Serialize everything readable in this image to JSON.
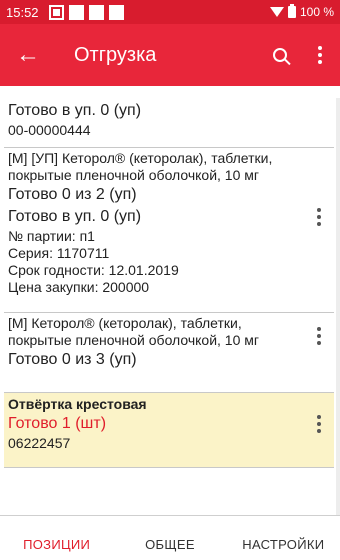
{
  "status_bar": {
    "time": "15:52",
    "battery": "100 %"
  },
  "app_bar": {
    "title": "Отгрузка",
    "icons": [
      "back-arrow-icon",
      "search-icon",
      "more-vert-icon"
    ]
  },
  "items": [
    {
      "line1": "Готово в уп. 0 (уп)",
      "line2": "00-00000444"
    },
    {
      "name": "[М] [УП] Кеторол® (кеторолак), таблетки, покрытые пленочной оболочкой, 10 мг",
      "ready": "Готово 0 из 2 (уп)",
      "ready_pack": "Готово в уп. 0 (уп)",
      "batch": "№ партии: п1",
      "series": "Серия: 1170711",
      "expiry": "Срок годности: 12.01.2019",
      "price": "Цена закупки: 200000"
    },
    {
      "name": "[М] Кеторол® (кеторолак), таблетки, покрытые пленочной оболочкой, 10 мг",
      "ready": "Готово 0 из 3 (уп)"
    },
    {
      "name": "Отвёртка крестовая",
      "ready": "Готово 1 (шт)",
      "barcode": "06222457",
      "highlight_color": "#fbf3c8"
    }
  ],
  "tabs": [
    {
      "label": "ПОЗИЦИИ",
      "active": true
    },
    {
      "label": "ОБЩЕЕ",
      "active": false
    },
    {
      "label": "НАСТРОЙКИ",
      "active": false
    }
  ],
  "colors": {
    "status_bar": "#d81c2e",
    "app_bar": "#e8263a",
    "accent_red": "#e01e2b"
  }
}
